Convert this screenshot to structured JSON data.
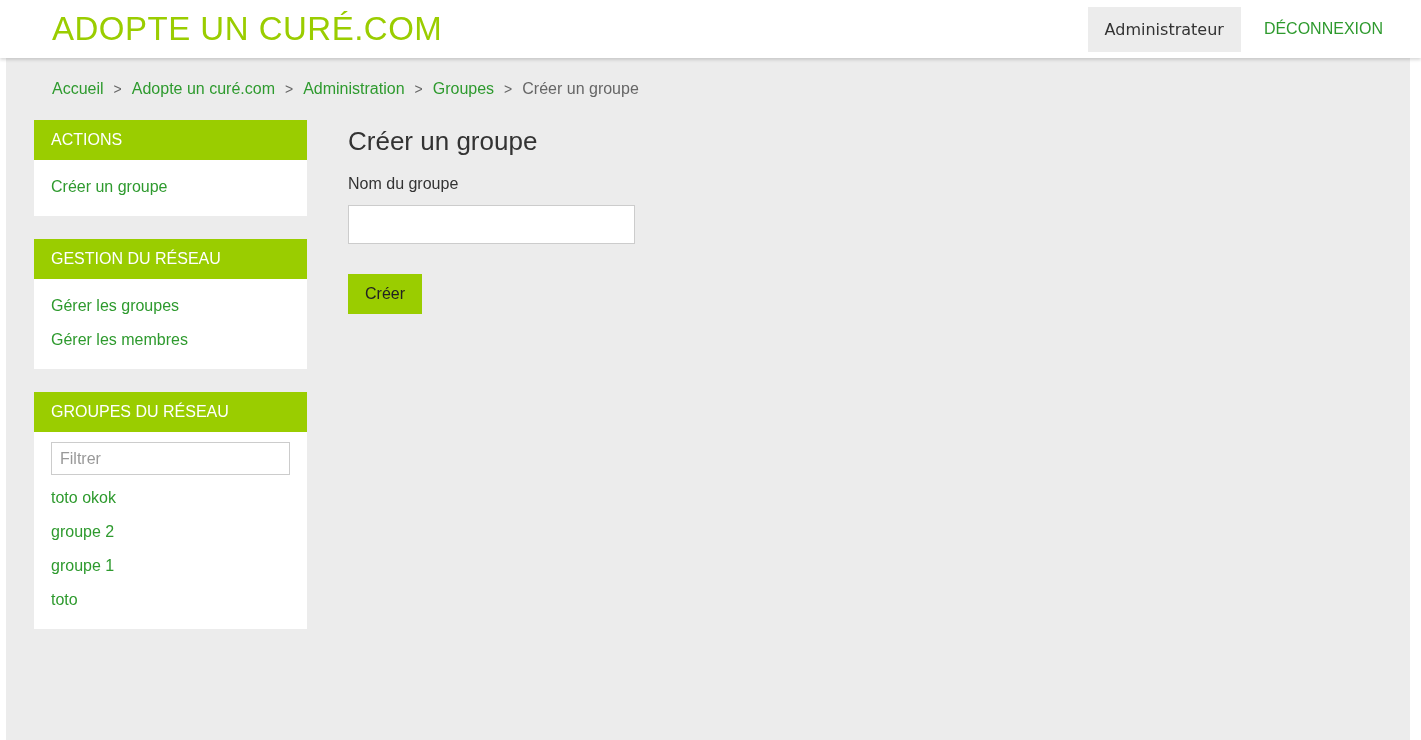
{
  "header": {
    "logo": "ADOPTE UN CURÉ.COM",
    "user": "Administrateur",
    "logout": "DÉCONNEXION"
  },
  "breadcrumb": [
    {
      "label": "Accueil",
      "current": false
    },
    {
      "label": "Adopte un curé.com",
      "current": false
    },
    {
      "label": "Administration",
      "current": false
    },
    {
      "label": "Groupes",
      "current": false
    },
    {
      "label": "Créer un groupe",
      "current": true
    }
  ],
  "breadcrumb_separator": ">",
  "sidebar": [
    {
      "title": "ACTIONS",
      "items": [
        "Créer un groupe"
      ]
    },
    {
      "title": "GESTION DU RÉSEAU",
      "items": [
        "Gérer les groupes",
        "Gérer les membres"
      ]
    },
    {
      "title": "GROUPES DU RÉSEAU",
      "filter": {
        "placeholder": "Filtrer"
      },
      "items": [
        "toto okok",
        "groupe 2",
        "groupe 1",
        "toto"
      ]
    }
  ],
  "form": {
    "title": "Créer un groupe",
    "field_label": "Nom du groupe",
    "submit": "Créer"
  }
}
